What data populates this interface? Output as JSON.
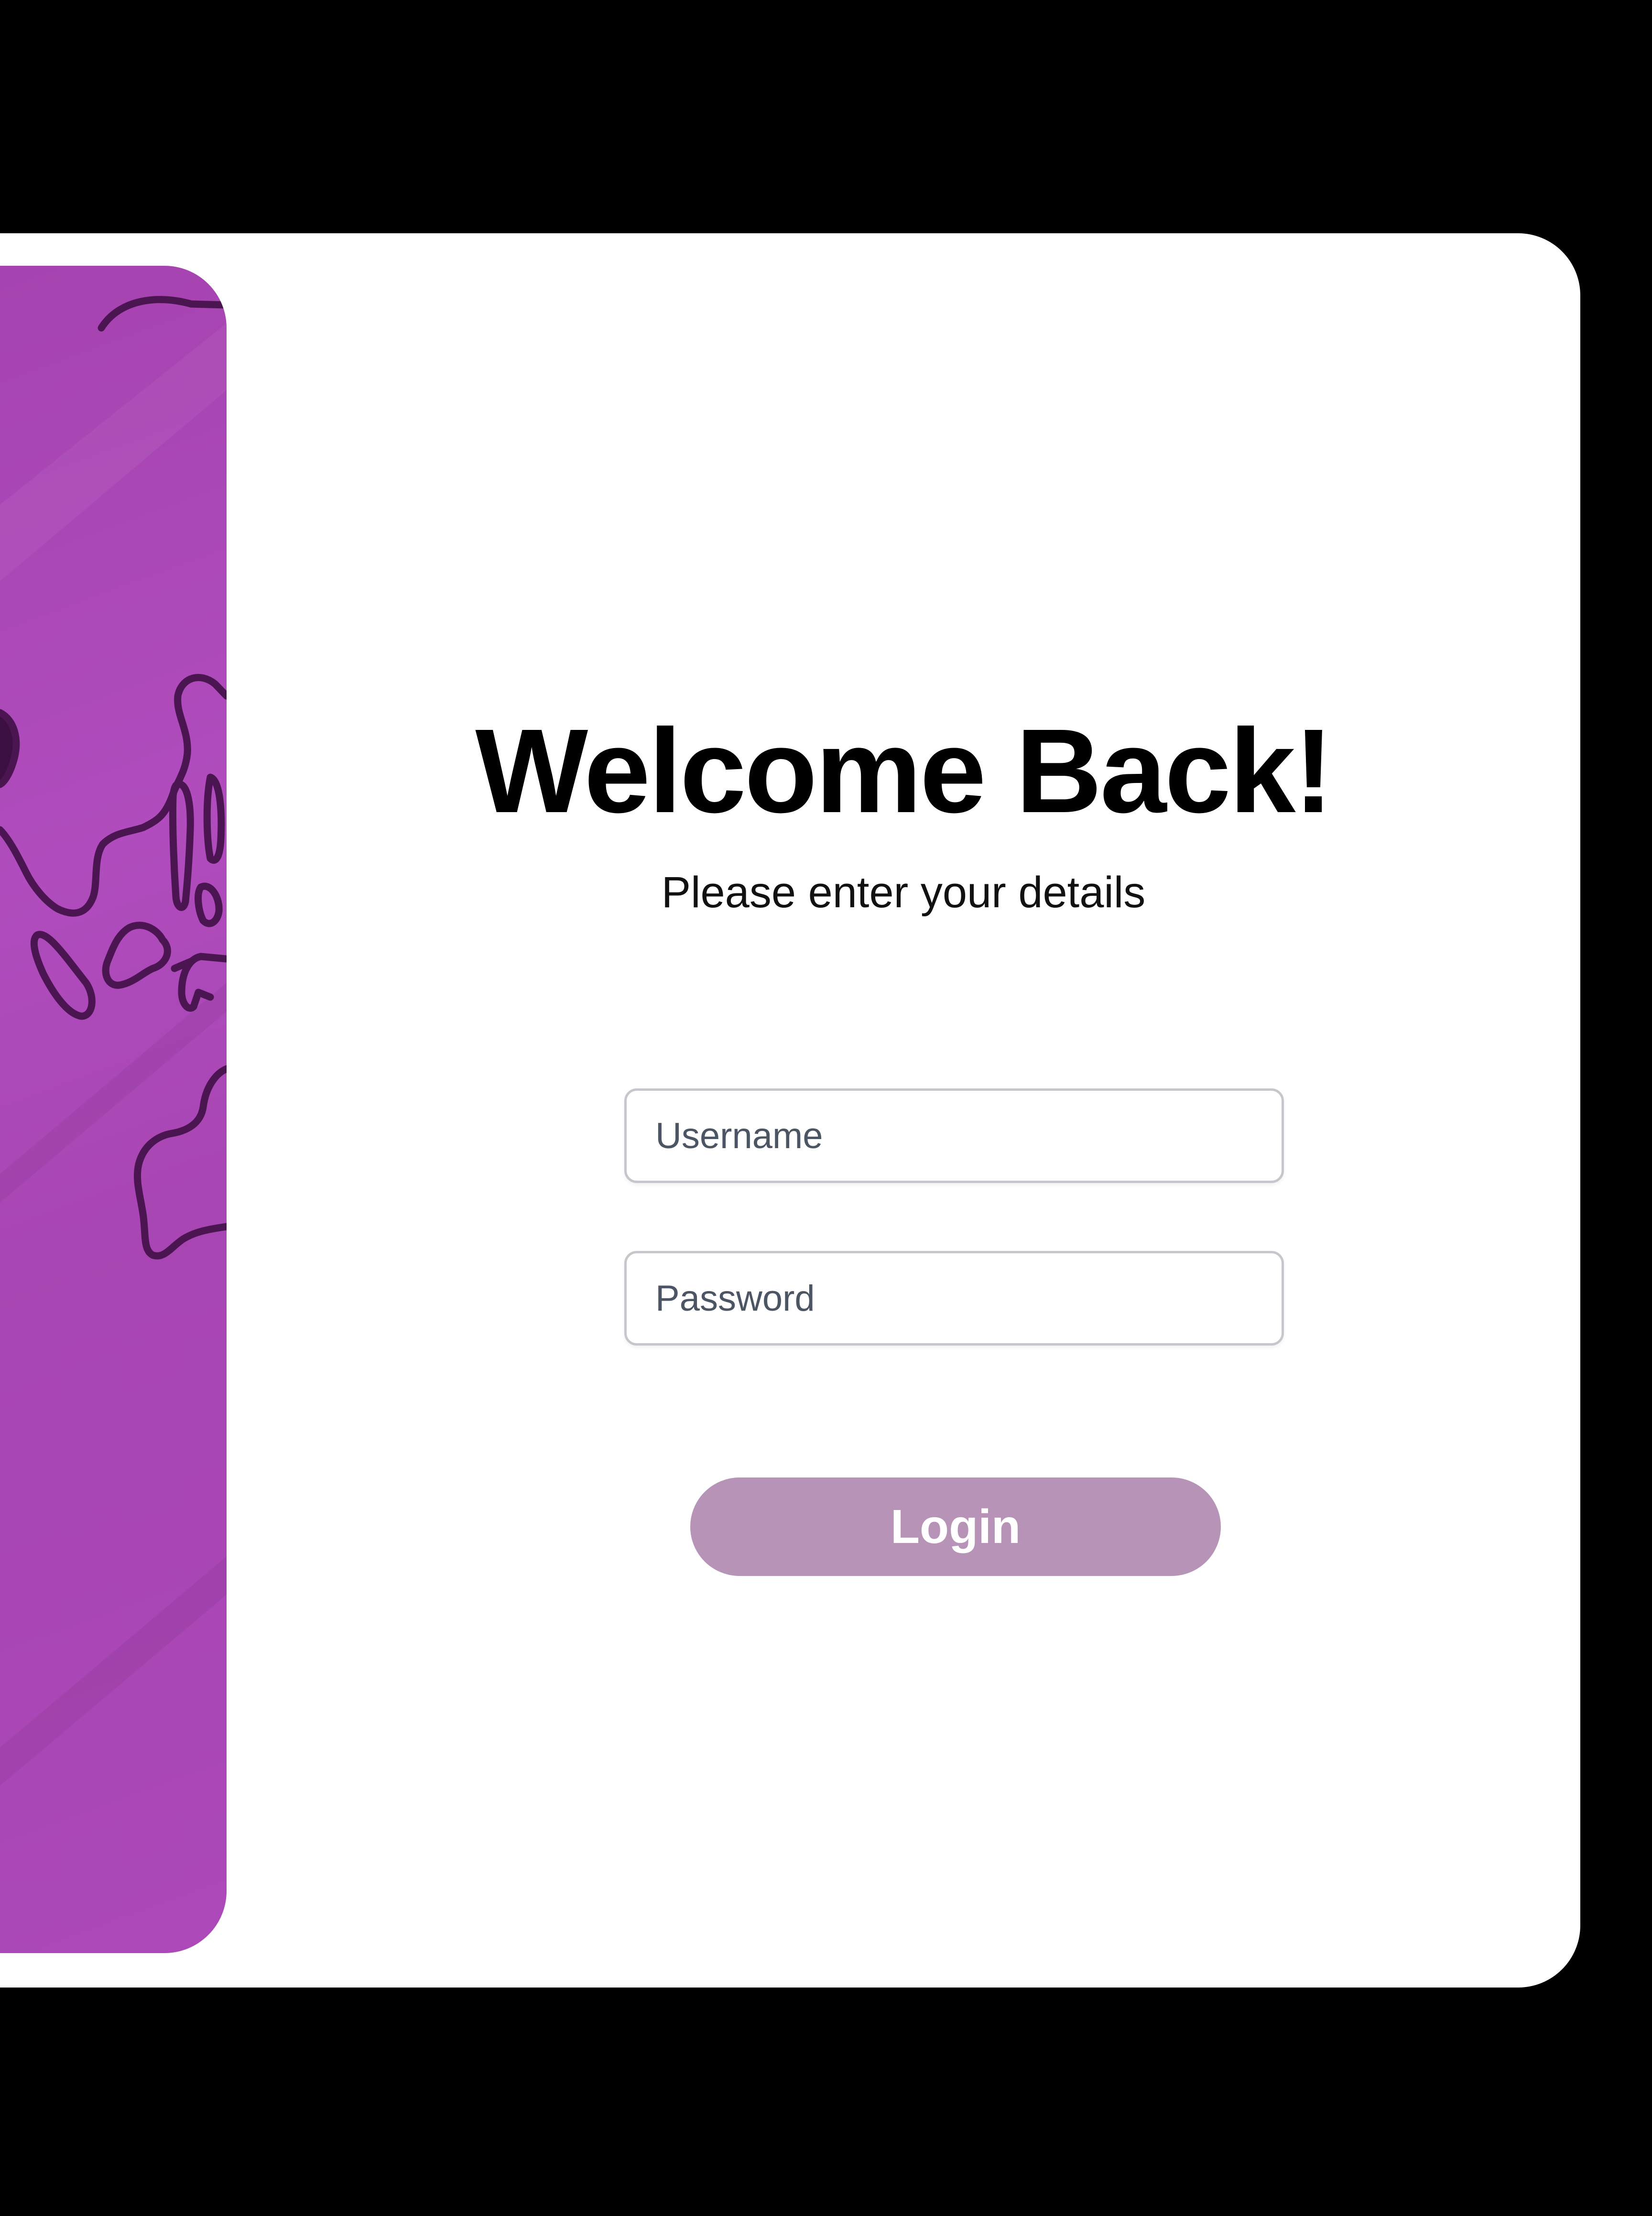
{
  "login": {
    "title": "Welcome Back!",
    "subtitle": "Please enter your details",
    "username_placeholder": "Username",
    "password_placeholder": "Password",
    "login_label": "Login"
  },
  "colors": {
    "background": "#000000",
    "card": "#ffffff",
    "panel": "#a846b4",
    "outline": "#4a1550",
    "button": "#b793b7",
    "button_text": "#ffffff"
  }
}
